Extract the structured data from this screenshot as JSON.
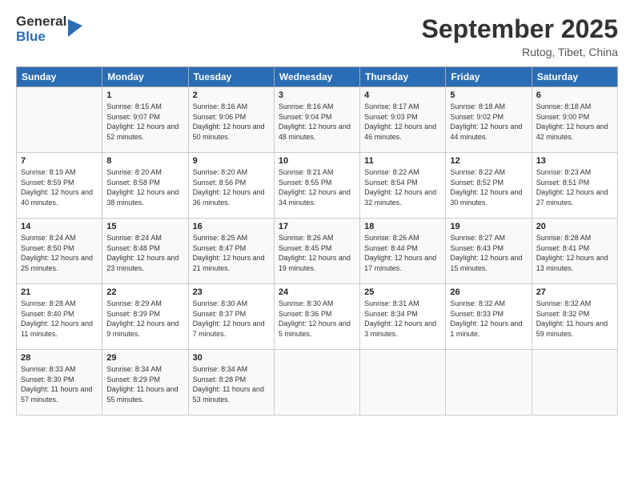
{
  "logo": {
    "general": "General",
    "blue": "Blue"
  },
  "header": {
    "month": "September 2025",
    "location": "Rutog, Tibet, China"
  },
  "weekdays": [
    "Sunday",
    "Monday",
    "Tuesday",
    "Wednesday",
    "Thursday",
    "Friday",
    "Saturday"
  ],
  "weeks": [
    [
      {
        "day": "",
        "sunrise": "",
        "sunset": "",
        "daylight": ""
      },
      {
        "day": "1",
        "sunrise": "Sunrise: 8:15 AM",
        "sunset": "Sunset: 9:07 PM",
        "daylight": "Daylight: 12 hours and 52 minutes."
      },
      {
        "day": "2",
        "sunrise": "Sunrise: 8:16 AM",
        "sunset": "Sunset: 9:06 PM",
        "daylight": "Daylight: 12 hours and 50 minutes."
      },
      {
        "day": "3",
        "sunrise": "Sunrise: 8:16 AM",
        "sunset": "Sunset: 9:04 PM",
        "daylight": "Daylight: 12 hours and 48 minutes."
      },
      {
        "day": "4",
        "sunrise": "Sunrise: 8:17 AM",
        "sunset": "Sunset: 9:03 PM",
        "daylight": "Daylight: 12 hours and 46 minutes."
      },
      {
        "day": "5",
        "sunrise": "Sunrise: 8:18 AM",
        "sunset": "Sunset: 9:02 PM",
        "daylight": "Daylight: 12 hours and 44 minutes."
      },
      {
        "day": "6",
        "sunrise": "Sunrise: 8:18 AM",
        "sunset": "Sunset: 9:00 PM",
        "daylight": "Daylight: 12 hours and 42 minutes."
      }
    ],
    [
      {
        "day": "7",
        "sunrise": "Sunrise: 8:19 AM",
        "sunset": "Sunset: 8:59 PM",
        "daylight": "Daylight: 12 hours and 40 minutes."
      },
      {
        "day": "8",
        "sunrise": "Sunrise: 8:20 AM",
        "sunset": "Sunset: 8:58 PM",
        "daylight": "Daylight: 12 hours and 38 minutes."
      },
      {
        "day": "9",
        "sunrise": "Sunrise: 8:20 AM",
        "sunset": "Sunset: 8:56 PM",
        "daylight": "Daylight: 12 hours and 36 minutes."
      },
      {
        "day": "10",
        "sunrise": "Sunrise: 8:21 AM",
        "sunset": "Sunset: 8:55 PM",
        "daylight": "Daylight: 12 hours and 34 minutes."
      },
      {
        "day": "11",
        "sunrise": "Sunrise: 8:22 AM",
        "sunset": "Sunset: 8:54 PM",
        "daylight": "Daylight: 12 hours and 32 minutes."
      },
      {
        "day": "12",
        "sunrise": "Sunrise: 8:22 AM",
        "sunset": "Sunset: 8:52 PM",
        "daylight": "Daylight: 12 hours and 30 minutes."
      },
      {
        "day": "13",
        "sunrise": "Sunrise: 8:23 AM",
        "sunset": "Sunset: 8:51 PM",
        "daylight": "Daylight: 12 hours and 27 minutes."
      }
    ],
    [
      {
        "day": "14",
        "sunrise": "Sunrise: 8:24 AM",
        "sunset": "Sunset: 8:50 PM",
        "daylight": "Daylight: 12 hours and 25 minutes."
      },
      {
        "day": "15",
        "sunrise": "Sunrise: 8:24 AM",
        "sunset": "Sunset: 8:48 PM",
        "daylight": "Daylight: 12 hours and 23 minutes."
      },
      {
        "day": "16",
        "sunrise": "Sunrise: 8:25 AM",
        "sunset": "Sunset: 8:47 PM",
        "daylight": "Daylight: 12 hours and 21 minutes."
      },
      {
        "day": "17",
        "sunrise": "Sunrise: 8:26 AM",
        "sunset": "Sunset: 8:45 PM",
        "daylight": "Daylight: 12 hours and 19 minutes."
      },
      {
        "day": "18",
        "sunrise": "Sunrise: 8:26 AM",
        "sunset": "Sunset: 8:44 PM",
        "daylight": "Daylight: 12 hours and 17 minutes."
      },
      {
        "day": "19",
        "sunrise": "Sunrise: 8:27 AM",
        "sunset": "Sunset: 8:43 PM",
        "daylight": "Daylight: 12 hours and 15 minutes."
      },
      {
        "day": "20",
        "sunrise": "Sunrise: 8:28 AM",
        "sunset": "Sunset: 8:41 PM",
        "daylight": "Daylight: 12 hours and 13 minutes."
      }
    ],
    [
      {
        "day": "21",
        "sunrise": "Sunrise: 8:28 AM",
        "sunset": "Sunset: 8:40 PM",
        "daylight": "Daylight: 12 hours and 11 minutes."
      },
      {
        "day": "22",
        "sunrise": "Sunrise: 8:29 AM",
        "sunset": "Sunset: 8:39 PM",
        "daylight": "Daylight: 12 hours and 9 minutes."
      },
      {
        "day": "23",
        "sunrise": "Sunrise: 8:30 AM",
        "sunset": "Sunset: 8:37 PM",
        "daylight": "Daylight: 12 hours and 7 minutes."
      },
      {
        "day": "24",
        "sunrise": "Sunrise: 8:30 AM",
        "sunset": "Sunset: 8:36 PM",
        "daylight": "Daylight: 12 hours and 5 minutes."
      },
      {
        "day": "25",
        "sunrise": "Sunrise: 8:31 AM",
        "sunset": "Sunset: 8:34 PM",
        "daylight": "Daylight: 12 hours and 3 minutes."
      },
      {
        "day": "26",
        "sunrise": "Sunrise: 8:32 AM",
        "sunset": "Sunset: 8:33 PM",
        "daylight": "Daylight: 12 hours and 1 minute."
      },
      {
        "day": "27",
        "sunrise": "Sunrise: 8:32 AM",
        "sunset": "Sunset: 8:32 PM",
        "daylight": "Daylight: 11 hours and 59 minutes."
      }
    ],
    [
      {
        "day": "28",
        "sunrise": "Sunrise: 8:33 AM",
        "sunset": "Sunset: 8:30 PM",
        "daylight": "Daylight: 11 hours and 57 minutes."
      },
      {
        "day": "29",
        "sunrise": "Sunrise: 8:34 AM",
        "sunset": "Sunset: 8:29 PM",
        "daylight": "Daylight: 11 hours and 55 minutes."
      },
      {
        "day": "30",
        "sunrise": "Sunrise: 8:34 AM",
        "sunset": "Sunset: 8:28 PM",
        "daylight": "Daylight: 11 hours and 53 minutes."
      },
      {
        "day": "",
        "sunrise": "",
        "sunset": "",
        "daylight": ""
      },
      {
        "day": "",
        "sunrise": "",
        "sunset": "",
        "daylight": ""
      },
      {
        "day": "",
        "sunrise": "",
        "sunset": "",
        "daylight": ""
      },
      {
        "day": "",
        "sunrise": "",
        "sunset": "",
        "daylight": ""
      }
    ]
  ]
}
